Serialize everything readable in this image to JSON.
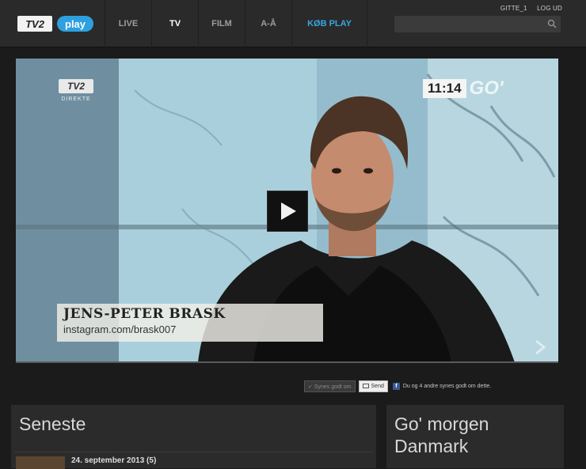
{
  "header": {
    "logo_text": "TV2",
    "logo_play": "play",
    "account": {
      "user": "GITTE_1",
      "logout": "LOG UD"
    },
    "nav": [
      {
        "label": "LIVE",
        "state": "normal"
      },
      {
        "label": "TV",
        "state": "active"
      },
      {
        "label": "FILM",
        "state": "normal"
      },
      {
        "label": "A-Å",
        "state": "normal"
      },
      {
        "label": "KØB PLAY",
        "state": "accent"
      }
    ],
    "search": {
      "placeholder": "",
      "value": ""
    }
  },
  "player": {
    "overlay_logo": "TV2",
    "overlay_live": "DIREKTE",
    "clock_time": "11:14",
    "clock_brand": "GO'",
    "lower_third_name": "JENS-PETER BRASK",
    "lower_third_sub": "instagram.com/brask007"
  },
  "social": {
    "like_label": "✓ Synes godt om",
    "send_label": "Send",
    "fb_text": "Du og 4 andre synes godt om dette."
  },
  "latest": {
    "title": "Seneste",
    "rows": [
      {
        "date": "24. september 2013 (5)",
        "extra": ""
      }
    ]
  },
  "show": {
    "title": "Go' morgen Danmark"
  },
  "colors": {
    "accent_blue": "#2ea0e0",
    "nav_buy": "#37a6e0",
    "background": "#1b1b1b",
    "panel": "#2b2b2b"
  }
}
